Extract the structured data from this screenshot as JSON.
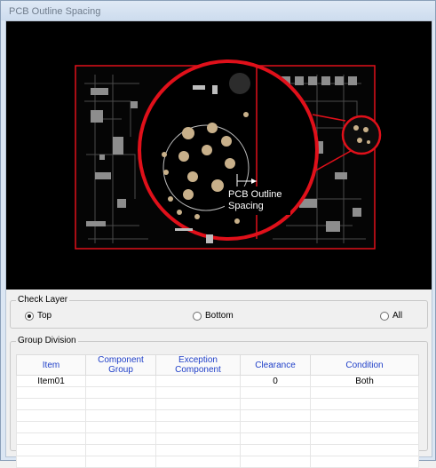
{
  "window": {
    "title": "PCB Outline Spacing"
  },
  "preview": {
    "callout_text_line1": "PCB Outline",
    "callout_text_line2": "Spacing"
  },
  "check_layer": {
    "label": "Check Layer",
    "options": [
      {
        "label": "Top",
        "selected": true
      },
      {
        "label": "Bottom",
        "selected": false
      },
      {
        "label": "All",
        "selected": false
      }
    ]
  },
  "group_division": {
    "label": "Group Division",
    "columns": [
      "Item",
      "Component Group",
      "Exception Component",
      "Clearance",
      "Condition"
    ],
    "rows": [
      {
        "item": "Item01",
        "component_group": "",
        "exception_component": "",
        "clearance": "0",
        "condition": "Both"
      }
    ]
  },
  "colors": {
    "header_text": "#1f3fc8",
    "pcb_outline": "#e0101a",
    "pad": "#c8b08a"
  }
}
